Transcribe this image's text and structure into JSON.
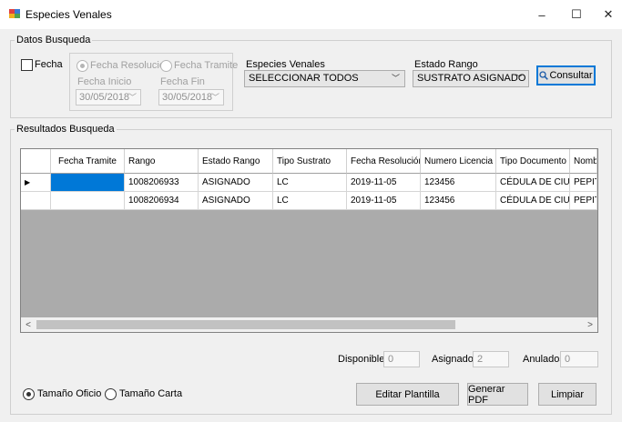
{
  "window": {
    "title": "Especies Venales",
    "minimize": "–",
    "maximize": "☐",
    "close": "✕"
  },
  "search": {
    "group_label": "Datos Busqueda",
    "fecha_label": "Fecha",
    "radio_resolucion": "Fecha Resolucion",
    "radio_tramite": "Fecha Tramite",
    "fecha_inicio_label": "Fecha Inicio",
    "fecha_inicio": "30/05/2018",
    "fecha_fin_label": "Fecha Fin",
    "fecha_fin": "30/05/2018",
    "especies_label": "Especies Venales",
    "especies_value": "SELECCIONAR TODOS",
    "estado_label": "Estado Rango",
    "estado_value": "SUSTRATO ASIGNADO",
    "consultar": "Consultar"
  },
  "results": {
    "group_label": "Resultados Busqueda",
    "columns": [
      "Fecha Tramite",
      "Rango",
      "Estado Rango",
      "Tipo Sustrato",
      "Fecha Resolución",
      "Numero Licencia",
      "Tipo Documento",
      "Nomb"
    ],
    "rows": [
      [
        "",
        "1008206933",
        "ASIGNADO",
        "LC",
        "2019-11-05",
        "123456",
        "CÉDULA DE CIU...",
        "PEPITO"
      ],
      [
        "",
        "1008206934",
        "ASIGNADO",
        "LC",
        "2019-11-05",
        "123456",
        "CÉDULA DE CIU...",
        "PEPITO"
      ]
    ],
    "row_indicator": "▶",
    "scroll_left": "<",
    "scroll_right": ">"
  },
  "counters": {
    "disponibles_label": "Disponibles",
    "disponibles": "0",
    "asignados_label": "Asignados",
    "asignados": "2",
    "anulados_label": "Anulados",
    "anulados": "0"
  },
  "footer": {
    "tamano_oficio": "Tamaño Oficio",
    "tamano_carta": "Tamaño Carta",
    "editar": "Editar Plantilla",
    "generar": "Generar PDF",
    "limpiar": "Limpiar"
  },
  "colors": {
    "selection": "#0078d7",
    "grid_background": "#ababab"
  }
}
